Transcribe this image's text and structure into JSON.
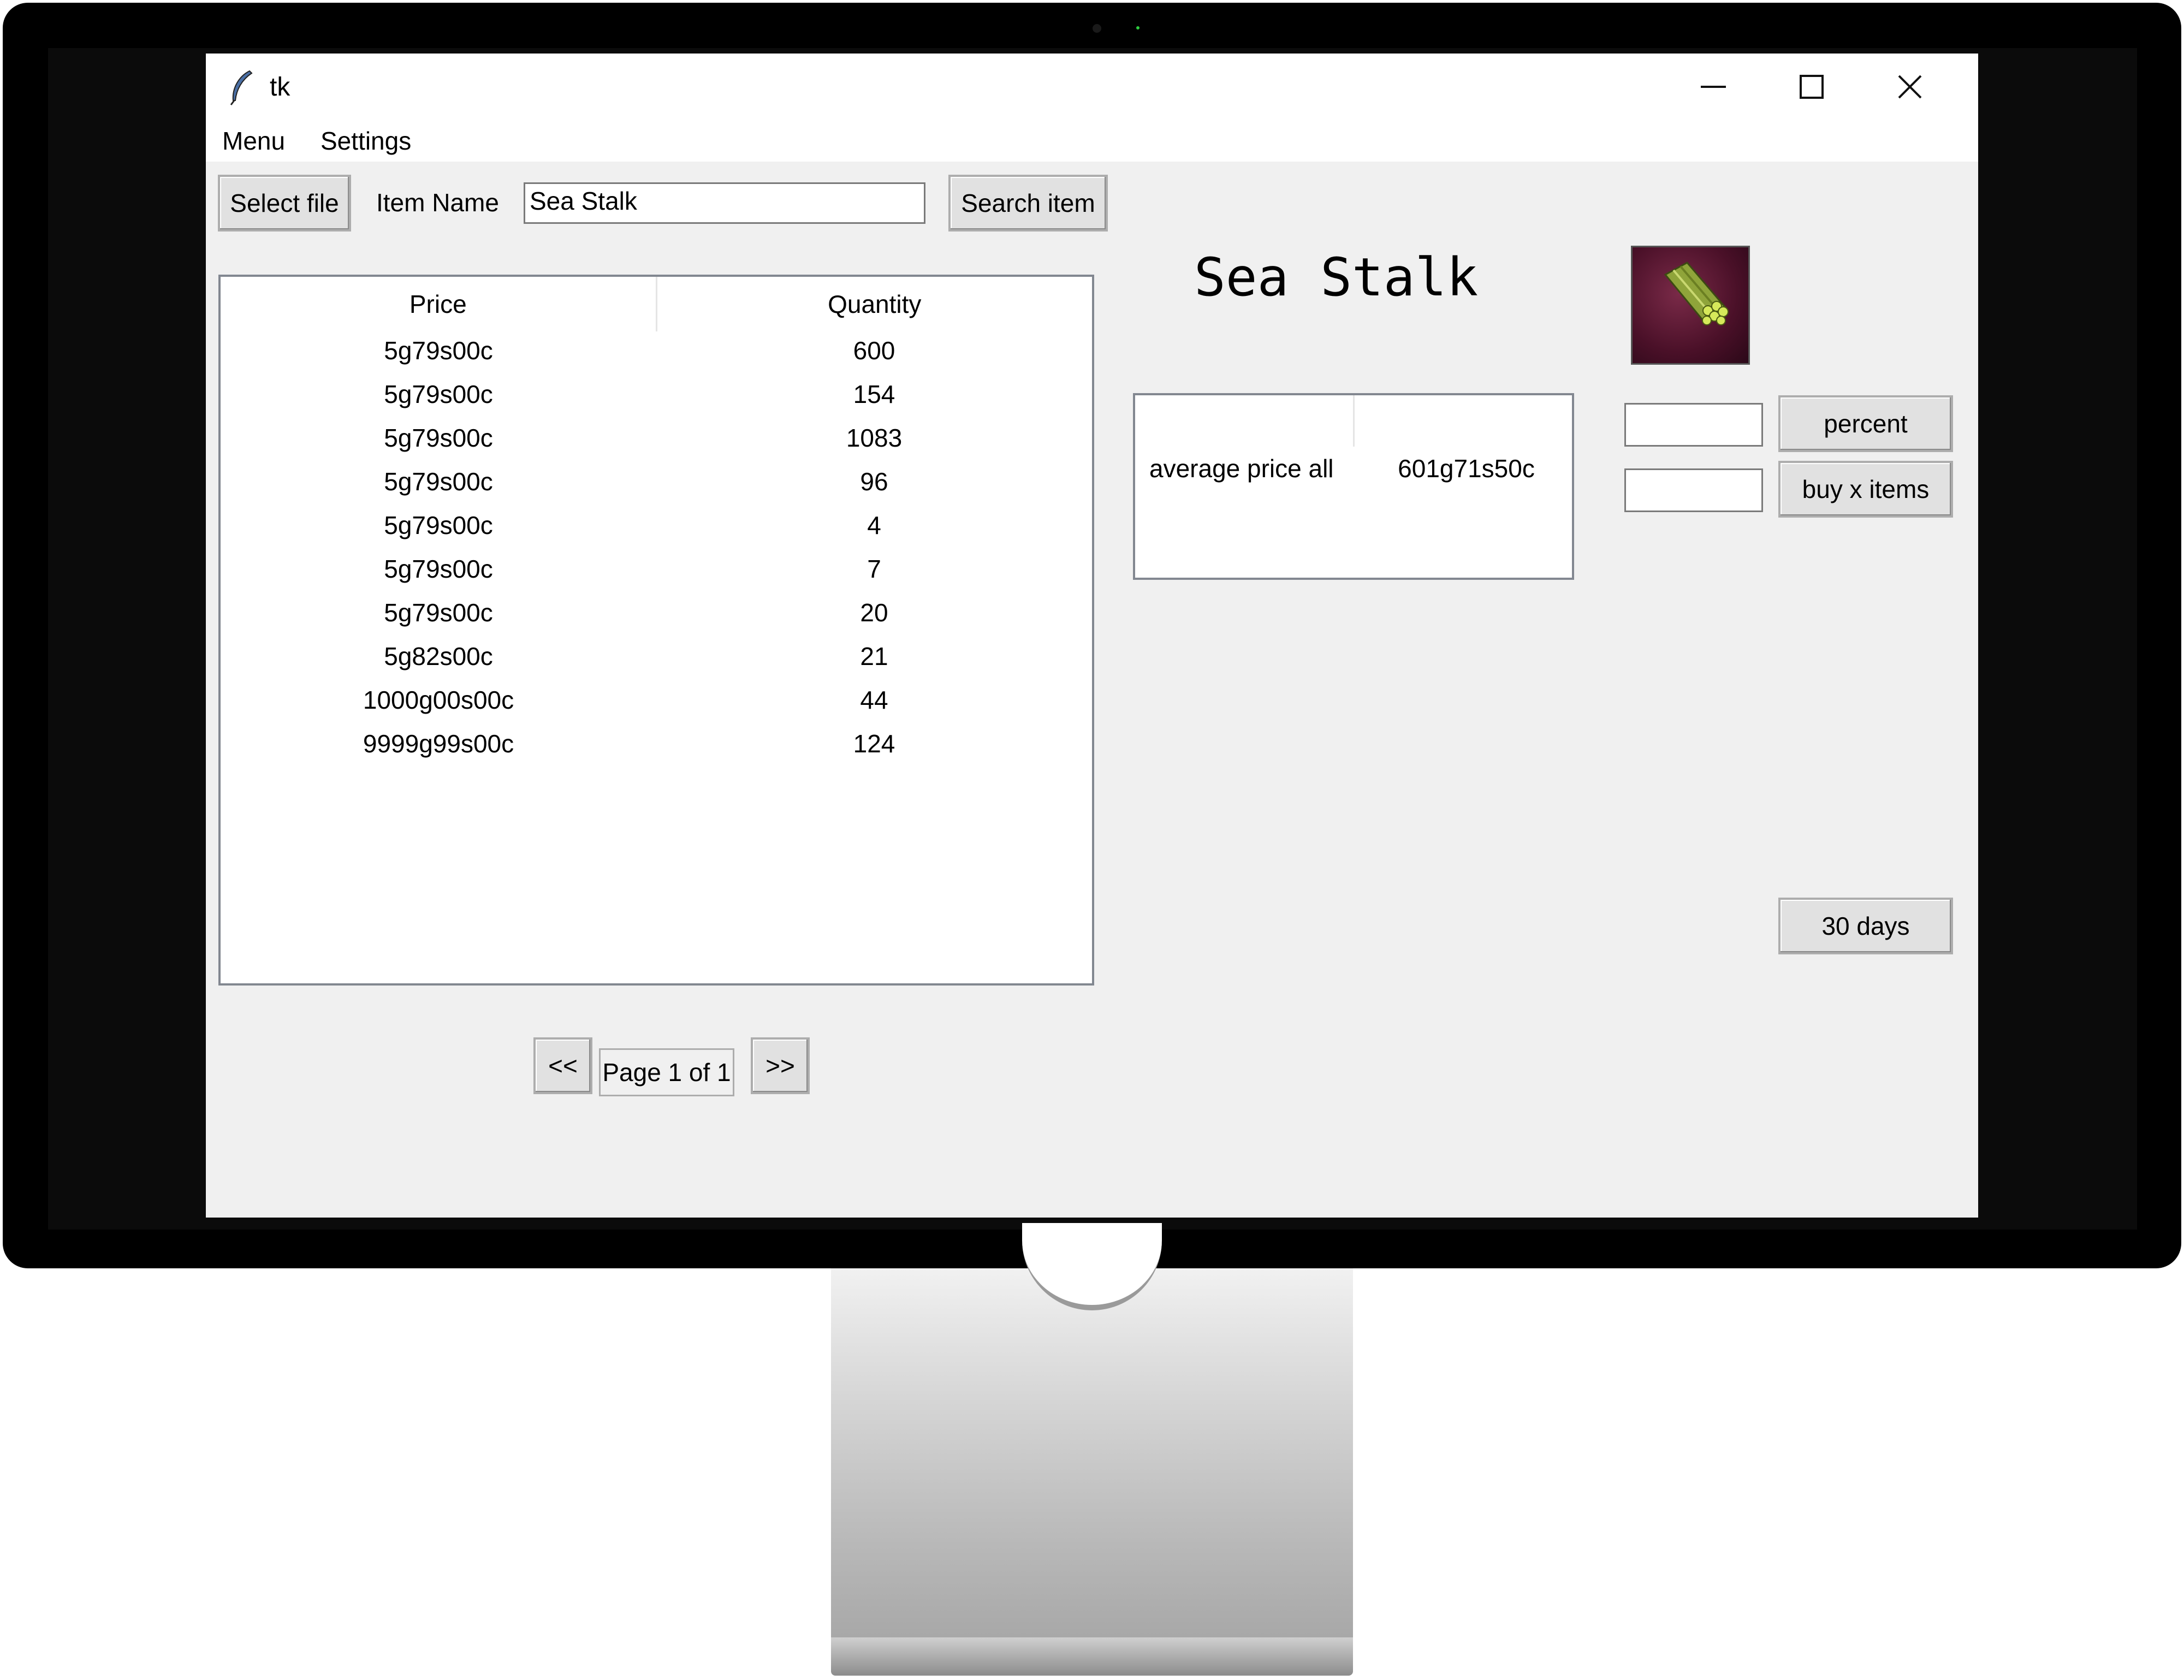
{
  "window": {
    "title": "tk",
    "controls": {
      "minimize": "–",
      "maximize": "☐",
      "close": "✕"
    }
  },
  "menubar": {
    "items": [
      "Menu",
      "Settings"
    ]
  },
  "toolbar": {
    "select_file_label": "Select file",
    "item_name_label": "Item Name",
    "item_name_value": "Sea Stalk",
    "search_label": "Search item"
  },
  "listings": {
    "columns": [
      "Price",
      "Quantity"
    ],
    "rows": [
      [
        "5g79s00c",
        "600"
      ],
      [
        "5g79s00c",
        "154"
      ],
      [
        "5g79s00c",
        "1083"
      ],
      [
        "5g79s00c",
        "96"
      ],
      [
        "5g79s00c",
        "4"
      ],
      [
        "5g79s00c",
        "7"
      ],
      [
        "5g79s00c",
        "20"
      ],
      [
        "5g82s00c",
        "21"
      ],
      [
        "1000g00s00c",
        "44"
      ],
      [
        "9999g99s00c",
        "124"
      ]
    ]
  },
  "item": {
    "name": "Sea Stalk",
    "icon": "sea-stalk-icon"
  },
  "stats": {
    "label": "average price all",
    "value": "601g71s50c"
  },
  "actions": {
    "percent_value": "",
    "percent_label": "percent",
    "buy_value": "",
    "buy_label": "buy x items",
    "days_label": "30 days"
  },
  "pager": {
    "prev_label": "<<",
    "page_label": "Page 1 of 1",
    "next_label": ">>"
  },
  "colors": {
    "window_bg": "#f0f0f0",
    "button_bg": "#e1e1e1",
    "monitor_bezel": "#000000"
  }
}
